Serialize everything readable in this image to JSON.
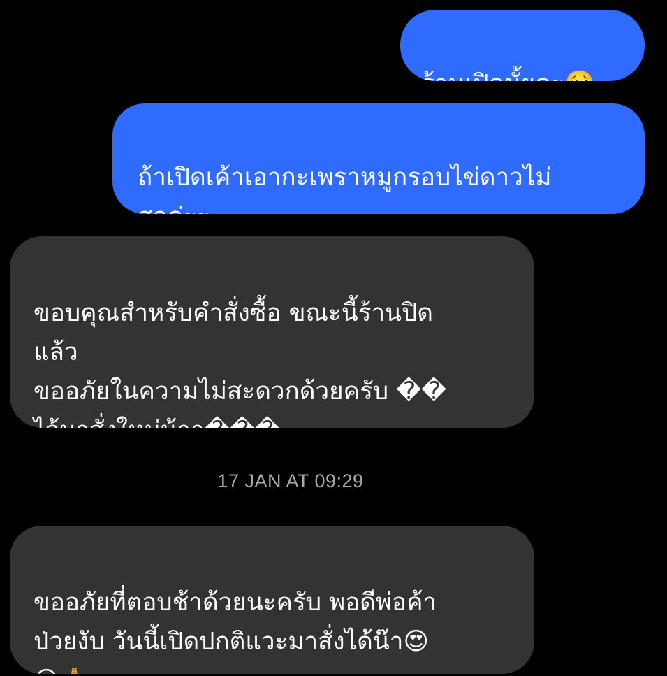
{
  "conversation": {
    "messages": [
      {
        "direction": "outgoing",
        "text": "ร้านเปิดมั้ยคะ🥺"
      },
      {
        "direction": "outgoing",
        "text": "ถ้าเปิดเค้าเอากะเพราหมูกรอบไข่ดาวไม่\nสุกค่ะะ"
      },
      {
        "direction": "incoming",
        "text": "ขอบคุณสำหรับคำสั่งซื้อ  ขณะนี้ร้านปิด\nแล้ว\nขออภัยในความไม่สะดวกด้วยครับ ��\nไว้มาสั่งใหม่น้าา���"
      },
      {
        "direction": "incoming",
        "text": "ขออภัยที่ตอบช้าด้วยนะครับ พอดีพ่อค้า\nป่วยงับ วันนี้เปิดปกติแวะมาสั่งได้น๊า😍\n😍🙏"
      }
    ],
    "timestamp": "17 JAN AT 09:29"
  },
  "colors": {
    "background": "#000000",
    "outgoing_bubble": "#2f6bff",
    "incoming_bubble": "#333333",
    "message_text": "#ffffff",
    "timestamp_text": "#a8a8a8"
  }
}
